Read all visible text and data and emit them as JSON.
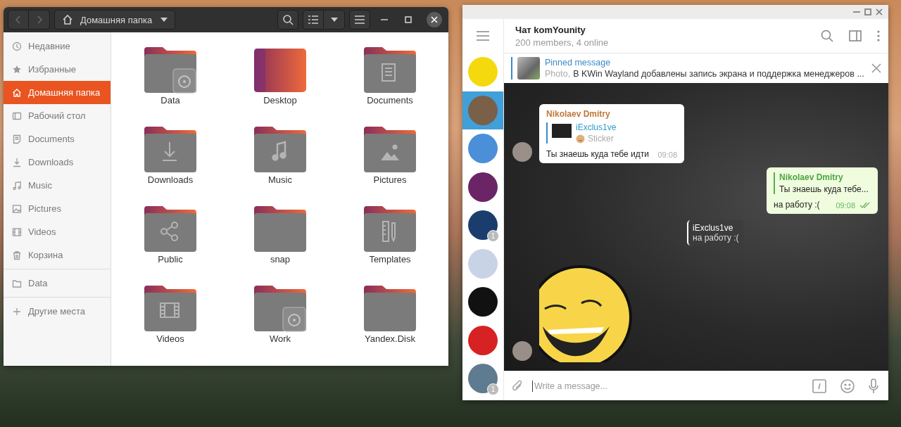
{
  "files_window": {
    "location": "Домашняя папка",
    "sidebar_sections": [
      {
        "items": [
          {
            "kind": "recent",
            "label": "Недавние",
            "selected": false
          },
          {
            "kind": "starred",
            "label": "Избранные",
            "selected": false
          },
          {
            "kind": "home",
            "label": "Домашняя папка",
            "selected": true
          },
          {
            "kind": "desktop",
            "label": "Рабочий стол",
            "selected": false
          },
          {
            "kind": "documents",
            "label": "Documents",
            "selected": false
          },
          {
            "kind": "downloads",
            "label": "Downloads",
            "selected": false
          },
          {
            "kind": "music",
            "label": "Music",
            "selected": false
          },
          {
            "kind": "pictures",
            "label": "Pictures",
            "selected": false
          },
          {
            "kind": "videos",
            "label": "Videos",
            "selected": false
          },
          {
            "kind": "trash",
            "label": "Корзина",
            "selected": false
          }
        ]
      },
      {
        "items": [
          {
            "kind": "folder",
            "label": "Data",
            "selected": false
          }
        ]
      },
      {
        "items": [
          {
            "kind": "plus",
            "label": "Другие места",
            "selected": false
          }
        ]
      }
    ],
    "folders": [
      {
        "kind": "plain",
        "name": "Data",
        "drive": true
      },
      {
        "kind": "desktop",
        "name": "Desktop",
        "drive": false
      },
      {
        "kind": "documents",
        "name": "Documents",
        "drive": false
      },
      {
        "kind": "downloads",
        "name": "Downloads",
        "drive": false
      },
      {
        "kind": "music",
        "name": "Music",
        "drive": false
      },
      {
        "kind": "pictures",
        "name": "Pictures",
        "drive": false
      },
      {
        "kind": "public",
        "name": "Public",
        "drive": false
      },
      {
        "kind": "plain",
        "name": "snap",
        "drive": false
      },
      {
        "kind": "templates",
        "name": "Templates",
        "drive": false
      },
      {
        "kind": "videos",
        "name": "Videos",
        "drive": false
      },
      {
        "kind": "plain",
        "name": "Work",
        "drive": true
      },
      {
        "kind": "plain",
        "name": "Yandex.Disk",
        "drive": false
      }
    ]
  },
  "telegram": {
    "chat_title": "Чат komYounity",
    "subtitle": "200 members, 4 online",
    "pinned": {
      "title": "Pinned message",
      "media": "Photo,",
      "text": "В KWin Wayland добавлены запись экрана и поддержка менеджеров ..."
    },
    "chats": [
      {
        "selected": false
      },
      {
        "selected": true
      },
      {
        "selected": false
      },
      {
        "selected": false
      },
      {
        "selected": false,
        "badge": "1"
      },
      {
        "selected": false
      },
      {
        "selected": false
      },
      {
        "selected": false
      },
      {
        "selected": false,
        "badge": "1"
      }
    ],
    "messages": [
      {
        "kind": "incoming",
        "sender": "Nikolaev Dmitry",
        "reply": {
          "author": "iExclus1ve",
          "kind": "sticker",
          "text": "Sticker"
        },
        "text": "Ты знаешь куда тебе идти",
        "time": "09:08"
      },
      {
        "kind": "outgoing",
        "reply": {
          "author": "Nikolaev Dmitry",
          "text": "Ты знаешь куда тебе..."
        },
        "text": "на работу :(",
        "time": "09:08",
        "read": true
      },
      {
        "kind": "sticker",
        "reply": {
          "author": "iExclus1ve",
          "text": "на работу :("
        }
      }
    ],
    "input_placeholder": "Write a message..."
  }
}
